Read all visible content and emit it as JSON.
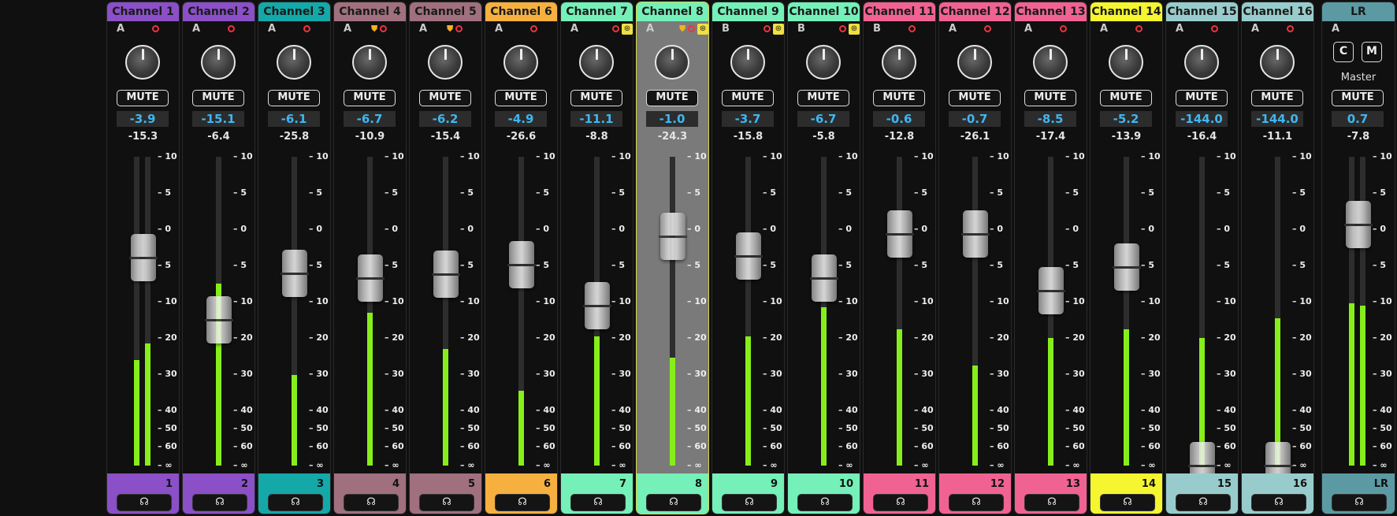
{
  "scale_labels": [
    "10",
    "5",
    "0",
    "5",
    "10",
    "20",
    "30",
    "40",
    "50",
    "60",
    "∞"
  ],
  "scale_values": [
    10,
    5,
    0,
    -5,
    -10,
    -20,
    -30,
    -40,
    -50,
    -60,
    -100
  ],
  "headphone_icon": "headphones-icon",
  "master_labels": {
    "c": "C",
    "m": "M",
    "title": "Master"
  },
  "mute_label": "MUTE",
  "colors": {
    "meter": "#86ee1a",
    "rec": "#ee3340",
    "gain_text": "#3fb6f2",
    "selected_border": "#d8d84a"
  },
  "channels": [
    {
      "name": "Channel 1",
      "bus": "A",
      "color": "#8b4fc8",
      "gain": "-3.9",
      "peak": "-15.3",
      "num": "1",
      "fader_db": -3.9,
      "meters": [
        -26,
        -21.5
      ],
      "shield": false,
      "lock": false
    },
    {
      "name": "Channel 2",
      "bus": "A",
      "color": "#8b4fc8",
      "gain": "-15.1",
      "peak": "-6.4",
      "num": "2",
      "fader_db": -15.1,
      "meters": [
        -7.5
      ],
      "shield": false,
      "lock": false
    },
    {
      "name": "Channel 3",
      "bus": "A",
      "color": "#14a8a8",
      "gain": "-6.1",
      "peak": "-25.8",
      "num": "3",
      "fader_db": -6.1,
      "meters": [
        -30.3
      ],
      "shield": false,
      "lock": false
    },
    {
      "name": "Channel 4",
      "bus": "A",
      "color": "#a0707e",
      "gain": "-6.7",
      "peak": "-10.9",
      "num": "4",
      "fader_db": -6.7,
      "meters": [
        -13
      ],
      "shield": true,
      "lock": false
    },
    {
      "name": "Channel 5",
      "bus": "A",
      "color": "#a0707e",
      "gain": "-6.2",
      "peak": "-15.4",
      "num": "5",
      "fader_db": -6.2,
      "meters": [
        -23
      ],
      "shield": true,
      "lock": false
    },
    {
      "name": "Channel 6",
      "bus": "A",
      "color": "#f5b040",
      "gain": "-4.9",
      "peak": "-26.6",
      "num": "6",
      "fader_db": -4.9,
      "meters": [
        -34.5
      ],
      "shield": false,
      "lock": false
    },
    {
      "name": "Channel 7",
      "bus": "A",
      "color": "#74f0b8",
      "gain": "-11.1",
      "peak": "-8.8",
      "num": "7",
      "fader_db": -11.1,
      "meters": [
        -19.5
      ],
      "shield": false,
      "lock": true
    },
    {
      "name": "Channel 8",
      "bus": "A",
      "color": "#74f0b8",
      "gain": "-1.0",
      "peak": "-24.3",
      "num": "8",
      "fader_db": -1.0,
      "meters": [
        -25.5
      ],
      "shield": true,
      "lock": true,
      "selected": true
    },
    {
      "name": "Channel 9",
      "bus": "B",
      "color": "#74f0b8",
      "gain": "-3.7",
      "peak": "-15.8",
      "num": "9",
      "fader_db": -3.7,
      "meters": [
        -19.5
      ],
      "shield": false,
      "lock": true
    },
    {
      "name": "Channel 10",
      "bus": "B",
      "color": "#74f0b8",
      "gain": "-6.7",
      "peak": "-5.8",
      "num": "10",
      "fader_db": -6.7,
      "meters": [
        -11.5
      ],
      "shield": false,
      "lock": true
    },
    {
      "name": "Channel 11",
      "bus": "B",
      "color": "#f06292",
      "gain": "-0.6",
      "peak": "-12.8",
      "num": "11",
      "fader_db": -0.6,
      "meters": [
        -17.5
      ],
      "shield": false,
      "lock": false
    },
    {
      "name": "Channel 12",
      "bus": "A",
      "color": "#f06292",
      "gain": "-0.7",
      "peak": "-26.1",
      "num": "12",
      "fader_db": -0.7,
      "meters": [
        -27.5
      ],
      "shield": false,
      "lock": false
    },
    {
      "name": "Channel 13",
      "bus": "A",
      "color": "#f06292",
      "gain": "-8.5",
      "peak": "-17.4",
      "num": "13",
      "fader_db": -8.5,
      "meters": [
        -20
      ],
      "shield": false,
      "lock": false
    },
    {
      "name": "Channel 14",
      "bus": "A",
      "color": "#f5f530",
      "gain": "-5.2",
      "peak": "-13.9",
      "num": "14",
      "fader_db": -5.2,
      "meters": [
        -17.5
      ],
      "shield": false,
      "lock": false
    },
    {
      "name": "Channel 15",
      "bus": "A",
      "color": "#98cccc",
      "gain": "-144.0",
      "peak": "-16.4",
      "num": "15",
      "fader_db": -100,
      "meters": [
        -20
      ],
      "shield": false,
      "lock": false
    },
    {
      "name": "Channel 16",
      "bus": "A",
      "color": "#98cccc",
      "gain": "-144.0",
      "peak": "-11.1",
      "num": "16",
      "fader_db": -100,
      "meters": [
        -14.5
      ],
      "shield": false,
      "lock": false
    },
    {
      "name": "LR",
      "bus": "A",
      "color": "#5b9aa3",
      "gain": "0.7",
      "peak": "-7.8",
      "num": "LR",
      "fader_db": 0.7,
      "meters": [
        -10.5,
        -11
      ],
      "shield": false,
      "lock": false,
      "master": true
    }
  ]
}
